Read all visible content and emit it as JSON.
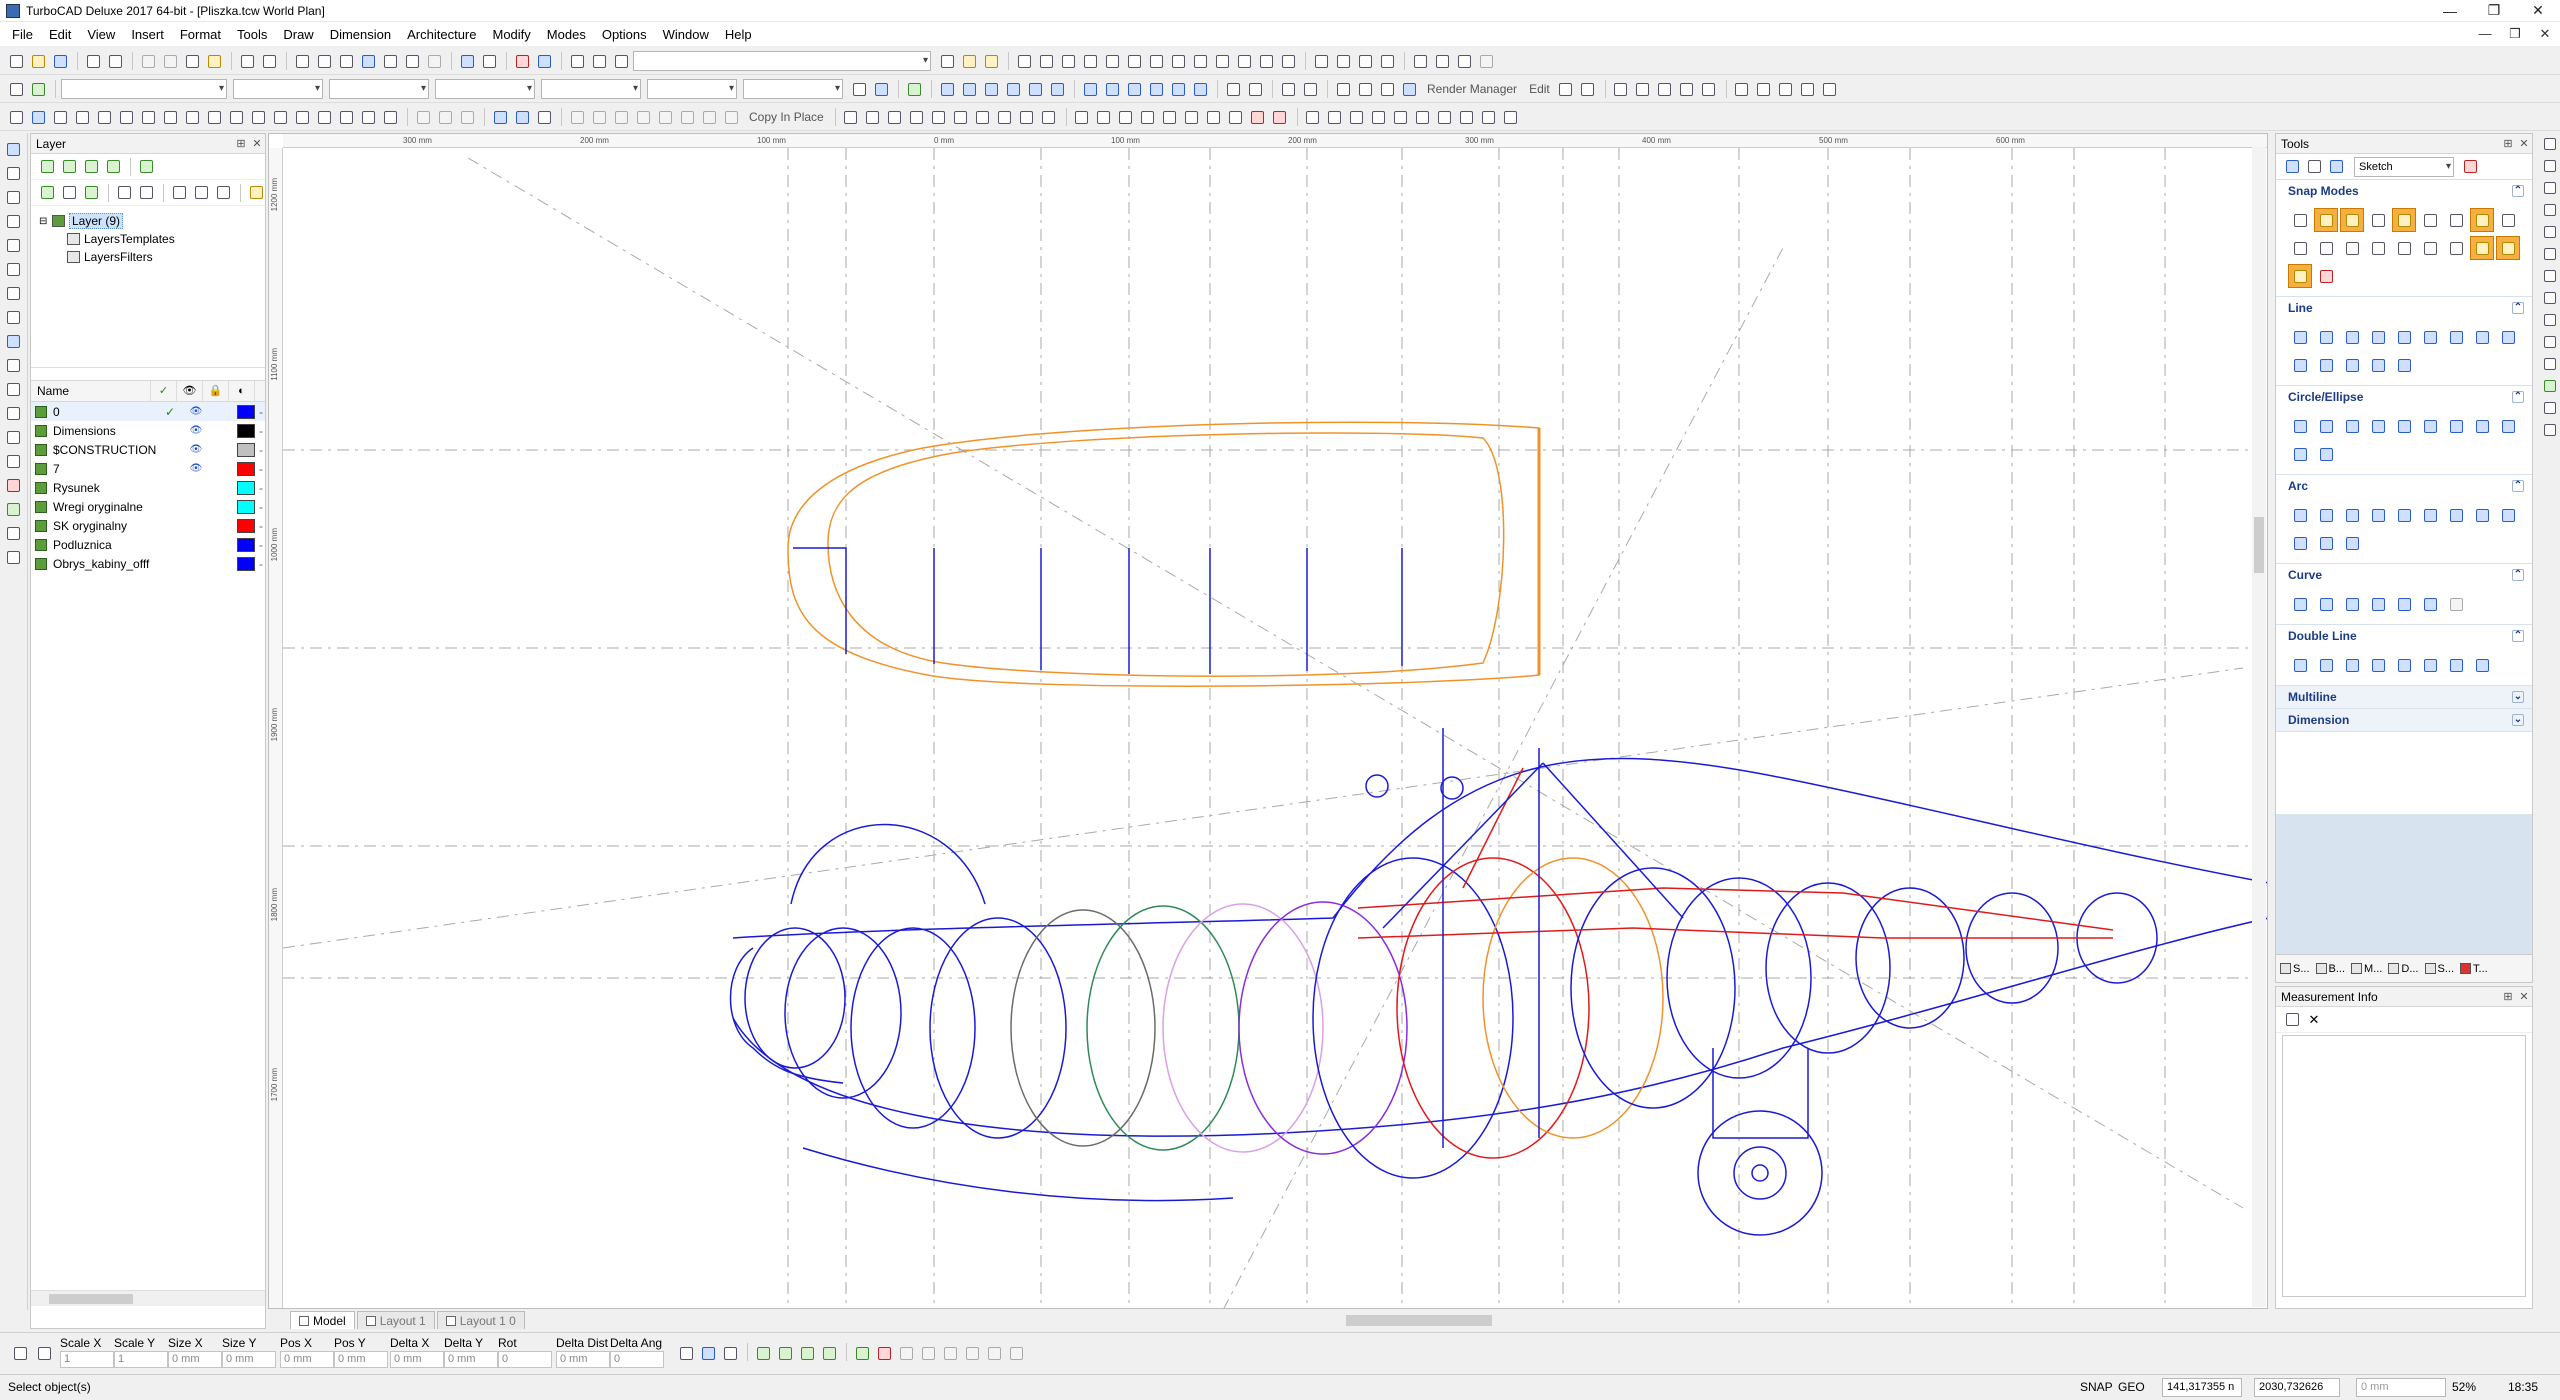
{
  "window": {
    "title": "TurboCAD Deluxe 2017 64-bit - [Pliszka.tcw World Plan]",
    "controls": {
      "minimize": "—",
      "maximize": "❐",
      "close": "✕"
    },
    "mdi_controls": {
      "minimize": "—",
      "restore": "❐",
      "close": "✕"
    }
  },
  "menu": [
    "File",
    "Edit",
    "View",
    "Insert",
    "Format",
    "Tools",
    "Draw",
    "Dimension",
    "Architecture",
    "Modify",
    "Modes",
    "Options",
    "Window",
    "Help"
  ],
  "toolbar2": {
    "render_manager": "Render Manager",
    "edit": "Edit"
  },
  "toolbar3": {
    "copy_in_place": "Copy In Place"
  },
  "layer_panel": {
    "title": "Layer",
    "tree": {
      "root": "Layer (9)",
      "children": [
        "LayersTemplates",
        "LayersFilters"
      ]
    },
    "columns": {
      "name": "Name",
      "current": "✓",
      "visible": "👁",
      "locked": "🔒",
      "color": "◐"
    },
    "layers": [
      {
        "name": "0",
        "current": "✓",
        "visible": "👁",
        "color": "#0000ff"
      },
      {
        "name": "Dimensions",
        "current": "",
        "visible": "👁",
        "color": "#000000"
      },
      {
        "name": "$CONSTRUCTION",
        "current": "",
        "visible": "👁",
        "color": "#c0c0c0"
      },
      {
        "name": "7",
        "current": "",
        "visible": "👁",
        "color": "#ff0000"
      },
      {
        "name": "Rysunek",
        "current": "",
        "visible": "",
        "color": "#00ffff"
      },
      {
        "name": "Wregi oryginalne",
        "current": "",
        "visible": "",
        "color": "#00ffff"
      },
      {
        "name": "SK oryginalny",
        "current": "",
        "visible": "",
        "color": "#ff0000"
      },
      {
        "name": "Podluznica",
        "current": "",
        "visible": "",
        "color": "#0000ff"
      },
      {
        "name": "Obrys_kabiny_offf",
        "current": "",
        "visible": "",
        "color": "#0000ff"
      }
    ]
  },
  "drawing": {
    "ruler_top": [
      "300 mm",
      "200 mm",
      "100 mm",
      "0 mm",
      "100 mm",
      "200 mm",
      "300 mm",
      "400 mm",
      "500 mm",
      "600 mm"
    ],
    "ruler_left": [
      "1200 mm",
      "1100 mm",
      "1000 mm",
      "1900 mm",
      "1800 mm",
      "1700 mm"
    ],
    "colors": {
      "orange": "#f0922a",
      "blue": "#1a1ad6",
      "red": "#e01a1a",
      "green": "#2e8b57",
      "pink": "#d9a0e6",
      "grey": "#b0b0b0"
    }
  },
  "layout_tabs": [
    "Model",
    "Layout 1",
    "Layout 1 0"
  ],
  "tools_panel": {
    "title": "Tools",
    "mode": "Sketch",
    "sections": [
      {
        "name": "Snap Modes",
        "expanded": true
      },
      {
        "name": "Line",
        "expanded": true
      },
      {
        "name": "Circle/Ellipse",
        "expanded": true
      },
      {
        "name": "Arc",
        "expanded": true
      },
      {
        "name": "Curve",
        "expanded": true
      },
      {
        "name": "Double Line",
        "expanded": true
      },
      {
        "name": "Multiline",
        "expanded": false
      },
      {
        "name": "Dimension",
        "expanded": false
      }
    ],
    "tabs": [
      "S...",
      "B...",
      "M...",
      "D...",
      "S...",
      "T..."
    ]
  },
  "measurement_panel": {
    "title": "Measurement Info"
  },
  "inspector": {
    "fields": [
      {
        "label": "Scale X",
        "value": "1"
      },
      {
        "label": "Scale Y",
        "value": "1"
      },
      {
        "label": "Size X",
        "value": "0 mm"
      },
      {
        "label": "Size Y",
        "value": "0 mm"
      },
      {
        "label": "Pos X",
        "value": "0 mm"
      },
      {
        "label": "Pos Y",
        "value": "0 mm"
      },
      {
        "label": "Delta X",
        "value": "0 mm"
      },
      {
        "label": "Delta Y",
        "value": "0 mm"
      },
      {
        "label": "Rot",
        "value": "0"
      },
      {
        "label": "Delta Dist",
        "value": "0 mm"
      },
      {
        "label": "Delta Ang",
        "value": "0"
      }
    ]
  },
  "status": {
    "message": "Select object(s)",
    "snap": "SNAP",
    "geo": "GEO",
    "x": "141,317355 n",
    "y": "2030,732626",
    "z": "0 mm",
    "zoom": "52%",
    "time": "18:35"
  }
}
